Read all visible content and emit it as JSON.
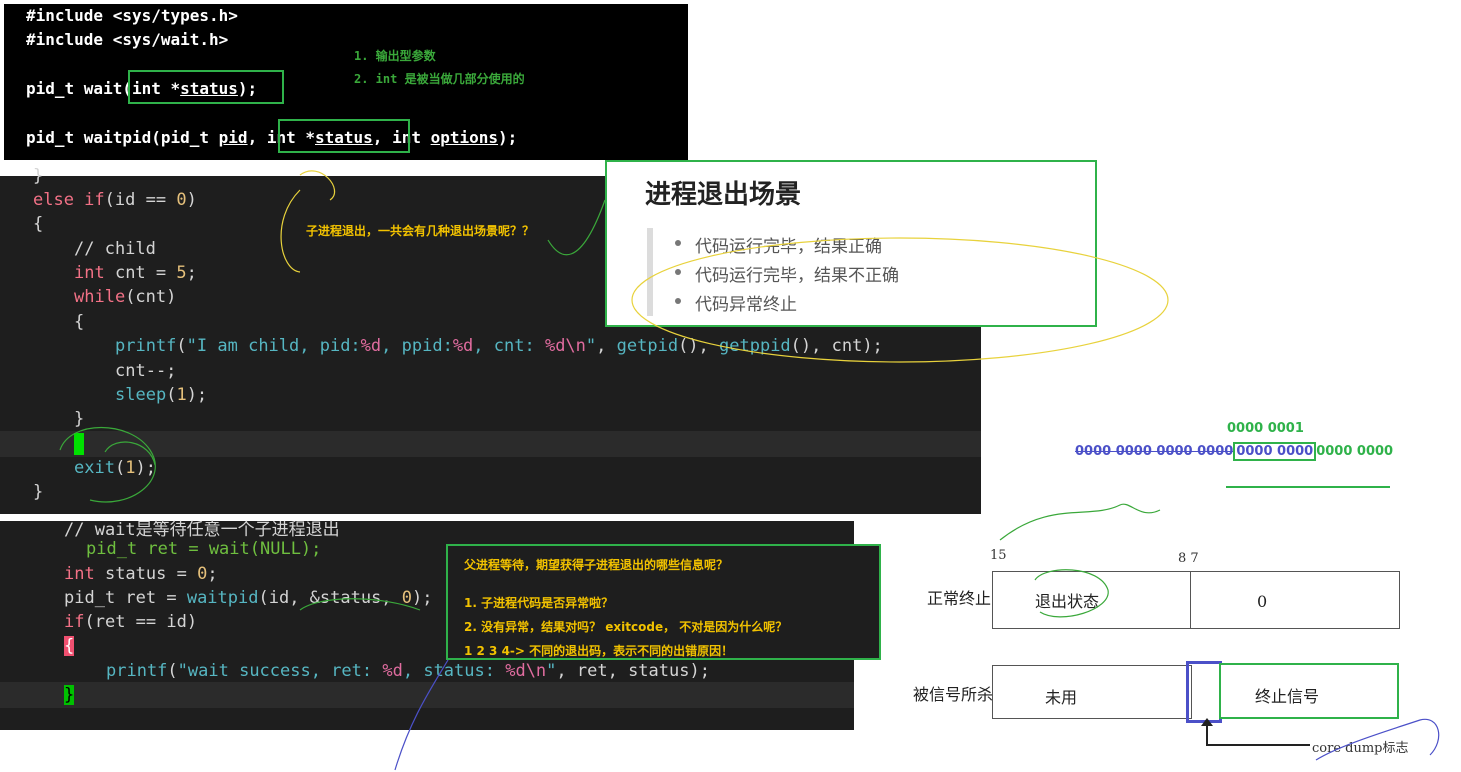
{
  "panel1": {
    "line1": "#include <sys/types.h>",
    "line2": "#include <sys/wait.h>",
    "line3_prefix": "pid_t wait",
    "line3_box": "(int *",
    "line3_status": "status",
    "line3_end": ");",
    "line4_prefix": "pid_t waitpid(pid_t ",
    "line4_pid": "pid",
    "line4_comma": ", ",
    "line4_box": "int *",
    "line4_status": "status",
    "line4_boxcomma": ",",
    "line4_rest": " int ",
    "line4_options": "options",
    "line4_end": ");",
    "anno1": "1. 输出型参数",
    "anno2": "2. int 是被当做几部分使用的"
  },
  "panel2": {
    "l0": "}",
    "l1_kw": "else if",
    "l1_rest": "(id == ",
    "l1_num": "0",
    "l1_end": ")",
    "l2": "{",
    "l3": "// child",
    "l4_kw": "int",
    "l4_rest": " cnt = ",
    "l4_num": "5",
    "l4_end": ";",
    "l5_kw": "while",
    "l5_rest": "(cnt)",
    "l6": "{",
    "l7_fn": "printf",
    "l7_open": "(",
    "l7_s1": "\"I am child, pid:",
    "l7_f1": "%d",
    "l7_s2": ", ppid:",
    "l7_f2": "%d",
    "l7_s3": ", cnt: ",
    "l7_f3": "%d\\n",
    "l7_s4": "\"",
    "l7_mid": ", ",
    "l7_fn2": "getpid",
    "l7_mid2": "(), ",
    "l7_fn3": "getppid",
    "l7_end": "(), cnt);",
    "l8": "cnt--;",
    "l9_fn": "sleep",
    "l9_open": "(",
    "l9_num": "1",
    "l9_end": ");",
    "l10": "}",
    "l11_fn": "exit",
    "l11_open": "(",
    "l11_num": "1",
    "l11_end": ");",
    "l12": "}",
    "anno": "子进程退出，一共会有几种退出场景呢？？"
  },
  "scene": {
    "title": "进程退出场景",
    "items": [
      "代码运行完毕，结果正确",
      "代码运行完毕，结果不正确",
      "代码异常终止"
    ]
  },
  "panel3": {
    "l0": "// wait是等待任意一个子进程退出",
    "l1": "pid_t ret = wait(NULL);",
    "l2_kw": "int",
    "l2_rest": " status = ",
    "l2_num": "0",
    "l2_end": ";",
    "l3_a": "pid_t ret = ",
    "l3_fn": "waitpid",
    "l3_b": "(id, &status, ",
    "l3_num": "0",
    "l3_end": ");",
    "l4_kw": "if",
    "l4_rest": "(ret == id)",
    "l5": "{",
    "l6_fn": "printf",
    "l6_open": "(",
    "l6_s1": "\"wait success, ret: ",
    "l6_f1": "%d",
    "l6_s2": ", status: ",
    "l6_f2": "%d\\n",
    "l6_s3": "\"",
    "l6_end": ", ret, status);",
    "l7": "}"
  },
  "info": {
    "q": "父进程等待，期望获得子进程退出的哪些信息呢？",
    "a1": "1. 子进程代码是否异常啦？",
    "a2": "2. 没有异常，结果对吗？ exitcode，  不对是因为什么呢？",
    "a3": "1 2 3 4-> 不同的退出码，表示不同的出错原因！"
  },
  "bits": {
    "top": "0000 0001",
    "struck": "0000 0000 0000 0000",
    "boxed": "0000 0000",
    "tail": "0000 0000"
  },
  "diagram": {
    "n15": "15",
    "n87": "8 7",
    "normal_label": "正常终止",
    "exit_status": "退出状态",
    "zero": "0",
    "signal_label": "被信号所杀",
    "unused": "未用",
    "term_signal": "终止信号",
    "core_dump": "core dump标志"
  },
  "colors": {
    "green": "#2fb24a",
    "blue": "#4b50c8",
    "yellow": "#f2c200"
  }
}
